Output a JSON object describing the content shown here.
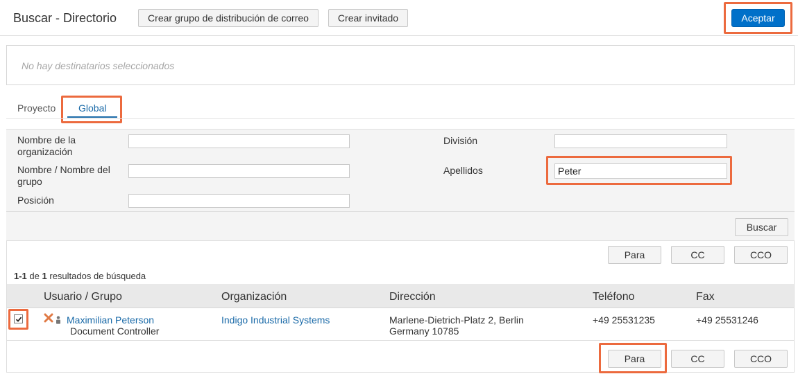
{
  "header": {
    "title": "Buscar - Directorio",
    "create_group_label": "Crear grupo de distribución de correo",
    "create_guest_label": "Crear invitado",
    "accept_label": "Aceptar"
  },
  "recipients": {
    "empty_text": "No hay destinatarios seleccionados"
  },
  "tabs": [
    {
      "label": "Proyecto",
      "active": false
    },
    {
      "label": "Global",
      "active": true
    }
  ],
  "form": {
    "org_name_label": "Nombre de la organización",
    "org_name_value": "",
    "group_name_label": "Nombre / Nombre del grupo",
    "group_name_value": "",
    "position_label": "Posición",
    "position_value": "",
    "division_label": "División",
    "division_value": "",
    "surname_label": "Apellidos",
    "surname_value": "Peter",
    "search_label": "Buscar"
  },
  "actions": {
    "to_label": "Para",
    "cc_label": "CC",
    "bcc_label": "CCO"
  },
  "results": {
    "range": "1-1",
    "of_text": "de",
    "total": "1",
    "suffix": "resultados de búsqueda",
    "columns": [
      "Usuario / Grupo",
      "Organización",
      "Dirección",
      "Teléfono",
      "Fax"
    ],
    "rows": [
      {
        "checked": true,
        "name": "Maximilian Peterson",
        "role": "Document Controller",
        "organization": "Indigo Industrial Systems",
        "address_line1": "Marlene-Dietrich-Platz 2, Berlin",
        "address_line2": "Germany 10785",
        "phone": "+49 25531235",
        "fax": "+49 25531246"
      }
    ]
  },
  "colors": {
    "accent": "#0070c9",
    "highlight": "#ec6a3e",
    "link": "#1a6aa8"
  }
}
